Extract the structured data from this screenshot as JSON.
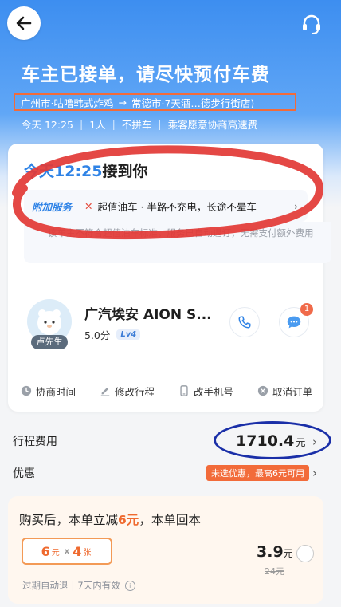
{
  "header": {
    "title": "车主已接单，请尽快预付车费",
    "route_from": "广州市·咕噜韩式炸鸡",
    "route_to": "常德市·7天酒…德步行街店)",
    "time": "今天 12:25",
    "passengers": "1人",
    "carpool": "不拼车",
    "highway": "乘客愿意协商高速费"
  },
  "pickup": {
    "time": "今天12:25",
    "suffix": "接到你"
  },
  "service": {
    "tag": "附加服务",
    "items": "超值油车 · 半路不充电，长途不晕车",
    "notice": "该车主不符合超值油车标准，服务已自动退订，无需支付额外费用"
  },
  "driver": {
    "name": "卢先生",
    "car": "广汽埃安 AION S...",
    "rating": "5.0分",
    "level": "Lv4",
    "message_badge": "1"
  },
  "actions": [
    {
      "label": "协商时间"
    },
    {
      "label": "修改行程"
    },
    {
      "label": "改手机号"
    },
    {
      "label": "取消订单"
    }
  ],
  "fee": {
    "label": "行程费用",
    "amount": "1710.4",
    "unit": "元",
    "discount_label": "优惠",
    "discount_text": "未选优惠，最高6元可用"
  },
  "promo": {
    "title_prefix": "购买后，本单立减",
    "title_amount": "6元",
    "title_suffix": "，本单回本",
    "coupon_value": "6",
    "coupon_unit": "元",
    "coupon_times": "x",
    "coupon_count": "4",
    "coupon_count_unit": "张",
    "price": "3.9",
    "price_unit": "元",
    "original_price": "24元",
    "expire_1": "过期自动退",
    "expire_2": "7天内有效"
  },
  "colors": {
    "brand_blue": "#2f83e6",
    "accent_orange": "#f26b3a",
    "annotation_red": "#e23a37",
    "annotation_blue": "#1a2fa8"
  }
}
